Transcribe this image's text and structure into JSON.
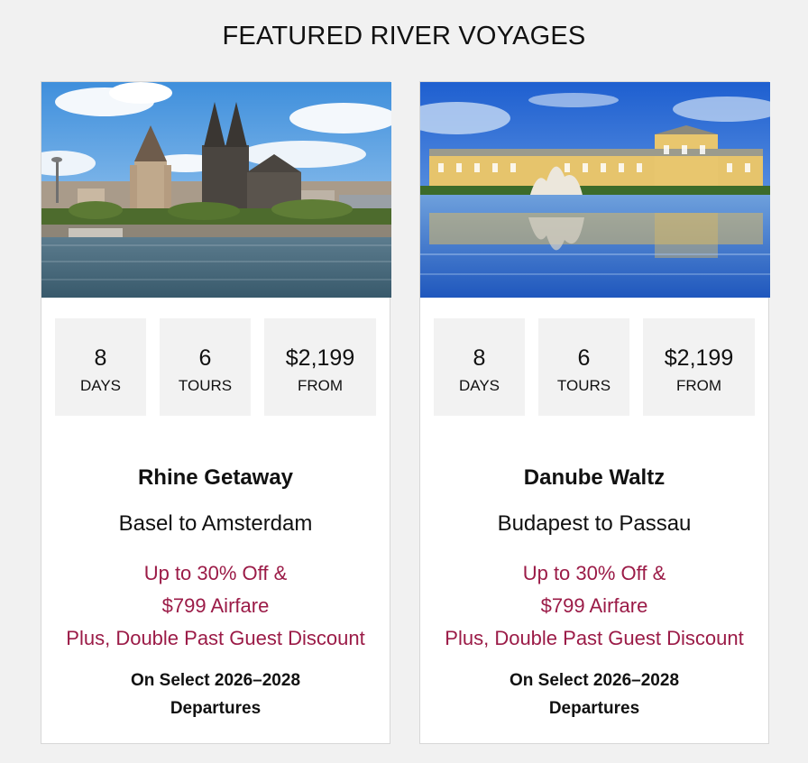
{
  "page": {
    "title": "FEATURED RIVER VOYAGES"
  },
  "colors": {
    "offer_text": "#9b1b47",
    "stat_bg": "#f2f2f2",
    "background": "#f1f1f1"
  },
  "cards": [
    {
      "image": "cologne-cathedral-riverfront-photo",
      "stats": [
        {
          "value": "8",
          "label": "DAYS"
        },
        {
          "value": "6",
          "label": "TOURS"
        },
        {
          "value": "$2,199",
          "label": "FROM"
        }
      ],
      "name": "Rhine Getaway",
      "route": "Basel to Amsterdam",
      "offer_lines": [
        "Up to 30% Off &",
        "$799 Airfare",
        "Plus, Double Past Guest Discount"
      ],
      "fine_lines": [
        "On Select 2026–2028",
        "Departures"
      ]
    },
    {
      "image": "schonbrunn-palace-fountain-photo",
      "stats": [
        {
          "value": "8",
          "label": "DAYS"
        },
        {
          "value": "6",
          "label": "TOURS"
        },
        {
          "value": "$2,199",
          "label": "FROM"
        }
      ],
      "name": "Danube Waltz",
      "route": "Budapest to Passau",
      "offer_lines": [
        "Up to 30% Off &",
        "$799 Airfare",
        "Plus, Double Past Guest Discount"
      ],
      "fine_lines": [
        "On Select 2026–2028",
        "Departures"
      ]
    }
  ]
}
